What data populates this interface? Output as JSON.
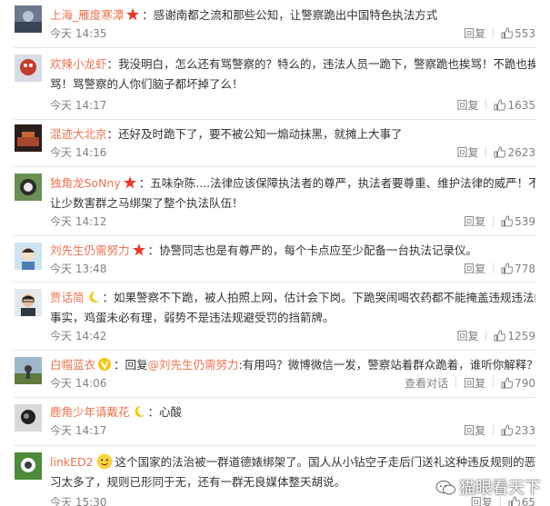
{
  "comments": [
    {
      "user": "上海_雁度寒潭",
      "badge": "star-badge",
      "text_lines": [
        "：感谢南都之流和那些公知，让警察跪出中国特色执法方式"
      ],
      "time": "今天 14:35",
      "reply": "回复",
      "likes": "553"
    },
    {
      "user": "欢辣小龙虾",
      "badge": "",
      "text_lines": [
        "：我没明白，怎么还有骂警察的？特么的，违法人员一跪下，警察跪也挨骂！不跪也挨",
        "骂！骂警察的人你们脑子都坏掉了么！"
      ],
      "time": "今天 14:17",
      "reply": "回复",
      "likes": "1635"
    },
    {
      "user": "混迹大北京",
      "badge": "",
      "text_lines": [
        "：还好及时跪下了，要不被公知一煽动抹黑，就摊上大事了"
      ],
      "time": "今天 14:16",
      "reply": "回复",
      "likes": "2623"
    },
    {
      "user": "独角龙SoNny",
      "badge": "star-badge",
      "text_lines": [
        "：五味杂陈....法律应该保障执法者的尊严，执法者要尊重、维护法律的威严！不能",
        "让少数害群之马绑架了整个执法队伍！"
      ],
      "time": "今天 14:12",
      "reply": "回复",
      "likes": "539"
    },
    {
      "user": "刘先生仍需努力",
      "badge": "star-badge",
      "text_lines": [
        "：协警同志也是有尊严的，每个卡点应至少配备一台执法记录仪。"
      ],
      "time": "今天 13:48",
      "reply": "回复",
      "likes": "778"
    },
    {
      "user": "贾话简",
      "badge": "moon-badge",
      "text_lines": [
        "：如果警察不下跪，被人拍照上网，估计会下岗。下跪哭闹喝农药都不能掩盖违规违法的",
        "事实，鸡蛋未必有理，弱势不是违法规避受罚的挡箭牌。"
      ],
      "time": "今天 14:42",
      "reply": "回复",
      "likes": "1259"
    },
    {
      "user": "白帽蓝衣",
      "badge": "v-badge",
      "text_lines": [
        "：回复",
        "@刘先生仍需努力",
        ":有用吗？微博微信一发，警察站着群众跪着，谁听你解释？"
      ],
      "time": "今天 14:06",
      "view_dialog": "查看对话",
      "reply": "回复",
      "likes": "790"
    },
    {
      "user": "鹿角少年请戴花",
      "badge": "moon-badge",
      "text_lines": [
        "：心酸"
      ],
      "time": "今天 14:17",
      "reply": "回复",
      "likes": "233"
    },
    {
      "user": "linkED2",
      "badge": "emoji-face",
      "text_lines": [
        "这个国家的法治被一群道德婊绑架了。国人从小钻空子走后门送礼这种违反规则的恶",
        "习太多了，规则已形同于无，还有一群无良媒体整天胡说。"
      ],
      "time": "今天 15:30",
      "reply": "回复",
      "likes": "65"
    }
  ],
  "watermark": "猫眼看天下",
  "colors": {
    "username": "#eb7350",
    "meta": "#808080",
    "divider": "#e6e6e6",
    "star": "#e8372c",
    "moon": "#f5c518"
  }
}
